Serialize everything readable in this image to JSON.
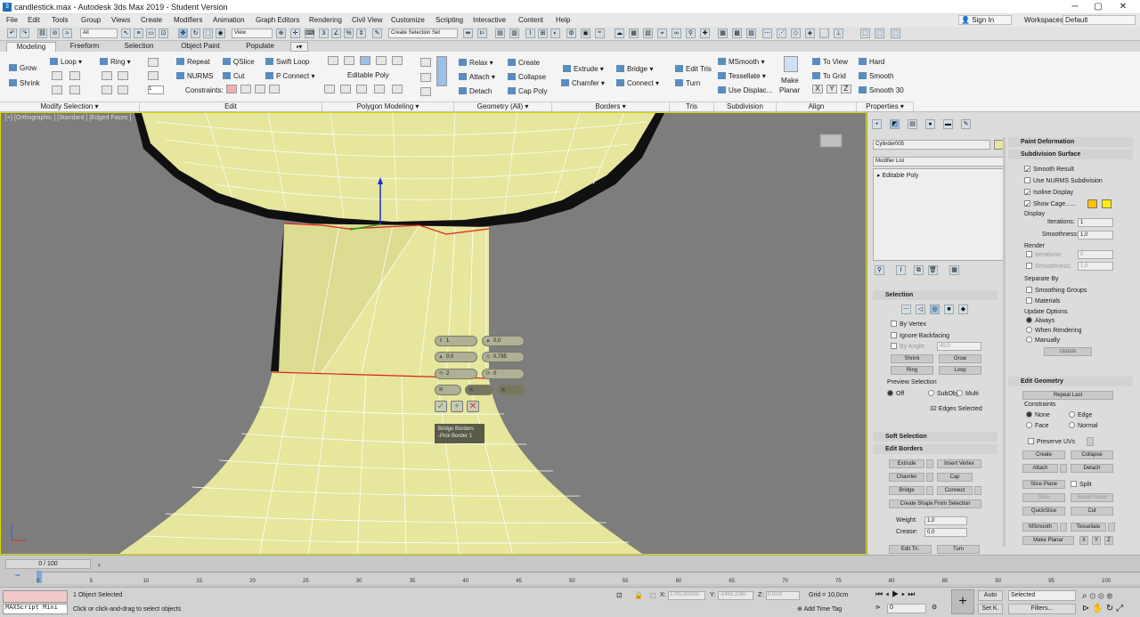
{
  "window": {
    "title": "candlestick.max - Autodesk 3ds Max 2019 - Student Version"
  },
  "menu": [
    "File",
    "Edit",
    "Tools",
    "Group",
    "Views",
    "Create",
    "Modifiers",
    "Animation",
    "Graph Editors",
    "Rendering",
    "Civil View",
    "Customize",
    "Scripting",
    "Interactive",
    "Content",
    "Help"
  ],
  "account": {
    "sign_in": "Sign In",
    "workspaces_label": "Workspaces:",
    "workspace": "Default"
  },
  "toolbar": {
    "filter": "All",
    "refcoord": "View",
    "selection_set": "Create Selection Set"
  },
  "ribbon_tabs": [
    "Modeling",
    "Freeform",
    "Selection",
    "Object Paint",
    "Populate"
  ],
  "ribbon": {
    "modify_selection": {
      "grow": "Grow",
      "shrink": "Shrink",
      "loop": "Loop",
      "ring": "Ring",
      "footer": "Modify Selection"
    },
    "edit": {
      "repeat": "Repeat",
      "qslice": "QSlice",
      "swift_loop": "Swift Loop",
      "nurms": "NURMS",
      "cut": "Cut",
      "p_connect": "P Connect",
      "constraints": "Constraints:",
      "footer": "Edit"
    },
    "polygon_modeling": {
      "label": "Editable Poly",
      "footer": "Polygon Modeling"
    },
    "geometry": {
      "relax": "Relax",
      "create": "Create",
      "attach": "Attach",
      "collapse": "Collapse",
      "detach": "Detach",
      "cap_poly": "Cap Poly",
      "footer": "Geometry (All)"
    },
    "borders": {
      "extrude": "Extrude",
      "bridge": "Bridge",
      "chamfer": "Chamfer",
      "connect": "Connect",
      "footer": "Borders"
    },
    "tris": {
      "edit_tris": "Edit Tris",
      "turn": "Turn",
      "footer": "Tris"
    },
    "subdivision": {
      "msmooth": "MSmooth",
      "tessellate": "Tessellate",
      "use_displac": "Use Displac...",
      "footer": "Subdivision"
    },
    "align": {
      "make_planar_1": "Make",
      "make_planar_2": "Planar",
      "to_view": "To View",
      "to_grid": "To Grid",
      "x": "X",
      "y": "Y",
      "z": "Z",
      "footer": "Align"
    },
    "properties": {
      "hard": "Hard",
      "smooth": "Smooth",
      "smooth30": "Smooth 30",
      "footer": "Properties"
    }
  },
  "viewport": {
    "label": "[+] [Orthographic ] [Standard ] [Edged Faces ]",
    "caddy": {
      "title": "Bridge Borders",
      "subtitle": "-Pick Border 1",
      "f1": "1",
      "f2": "0,0",
      "f3": "0,0",
      "f4": "0,785",
      "f5": "2",
      "f6": "0"
    }
  },
  "command_panel": {
    "object_name": "Cylinder005",
    "modifier_list": "Modifier List",
    "stack_item": "Editable Poly",
    "selection": {
      "title": "Selection",
      "by_vertex": "By Vertex",
      "ignore_backfacing": "Ignore Backfacing",
      "by_angle": "By Angle:",
      "angle": "45,0",
      "shrink": "Shrink",
      "grow": "Grow",
      "ring": "Ring",
      "loop": "Loop",
      "preview": "Preview Selection",
      "off": "Off",
      "subobj": "SubObj",
      "multi": "Multi",
      "status": "32 Edges Selected"
    },
    "soft_selection": "Soft Selection",
    "edit_borders": {
      "title": "Edit Borders",
      "extrude": "Extrude",
      "insert_vertex": "Insert Vertex",
      "chamfer": "Chamfer",
      "cap": "Cap",
      "bridge": "Bridge",
      "connect": "Connect",
      "create_shape": "Create Shape From Selection",
      "weight_label": "Weight:",
      "weight": "1,0",
      "crease_label": "Crease:",
      "crease": "0,0",
      "edit_tri": "Edit Tri.",
      "turn": "Turn"
    },
    "paint_deformation": "Paint Deformation",
    "subdivision": {
      "title": "Subdivision Surface",
      "smooth_result": "Smooth Result",
      "use_nurms": "Use NURMS Subdivision",
      "isoline": "Isoline Display",
      "show_cage": "Show Cage......",
      "display": "Display",
      "iterations_label": "Iterations:",
      "iterations": "1",
      "smoothness_label": "Smoothness:",
      "smoothness": "1,0",
      "render": "Render",
      "r_iterations": "0",
      "r_smoothness": "1,0",
      "separate_by": "Separate By",
      "smoothing_groups": "Smoothing Groups",
      "materials": "Materials",
      "update_options": "Update Options",
      "always": "Always",
      "when_rendering": "When Rendering",
      "manually": "Manually",
      "update": "Update"
    },
    "edit_geometry": {
      "title": "Edit Geometry",
      "repeat_last": "Repeat Last",
      "constraints": "Constraints",
      "none": "None",
      "edge": "Edge",
      "face": "Face",
      "normal": "Normal",
      "preserve_uvs": "Preserve UVs",
      "create": "Create",
      "collapse": "Collapse",
      "attach": "Attach",
      "detach": "Detach",
      "slice_plane": "Slice Plane",
      "split": "Split",
      "slice": "Slice",
      "reset_plane": "Reset Plane",
      "quickslice": "QuickSlice",
      "cut": "Cut",
      "msmooth": "MSmooth",
      "tessellate": "Tessellate",
      "make_planar": "Make Planar",
      "x": "X",
      "y": "Y",
      "z": "Z"
    }
  },
  "timeline": {
    "frame": "0 / 100",
    "ticks": [
      "0",
      "5",
      "10",
      "15",
      "20",
      "25",
      "30",
      "35",
      "40",
      "45",
      "50",
      "55",
      "60",
      "65",
      "70",
      "75",
      "80",
      "85",
      "90",
      "95",
      "100"
    ]
  },
  "status": {
    "script": "MAXScript Mini",
    "selected": "1 Object Selected",
    "hint": "Click or click-and-drag to select objects",
    "x_label": "X:",
    "x": "1705,302cm",
    "y_label": "Y:",
    "y": "-1451,226c",
    "z_label": "Z:",
    "z": "0,0cm",
    "grid": "Grid = 10,0cm",
    "add_time_tag": "Add Time Tag",
    "auto": "Auto",
    "set_k": "Set K.",
    "key_mode": "Selected",
    "filters": "Filters...",
    "time": "0"
  },
  "colors": {
    "object": "#e6e69c",
    "cage": "#ffc000",
    "viewport_bg": "#7d7d7d",
    "selected_edge": "#e02020"
  }
}
